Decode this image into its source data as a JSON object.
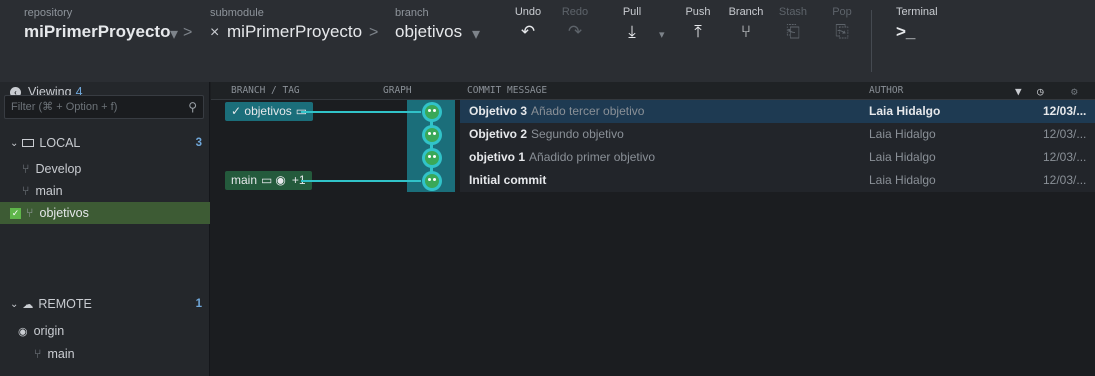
{
  "toolbar": {
    "repo_caption": "repository",
    "repo_name": "miPrimerProyecto",
    "submodule_caption": "submodule",
    "submodule_name": "miPrimerProyecto",
    "branch_caption": "branch",
    "branch_name": "objetivos",
    "chevron": "▾",
    "sep": ">",
    "close": "×",
    "buttons": [
      {
        "label": "Undo",
        "icon": "↶"
      },
      {
        "label": "Redo",
        "icon": "↷"
      },
      {
        "label": "Pull",
        "icon": "⤓"
      },
      {
        "label": "Push",
        "icon": "⤒"
      },
      {
        "label": "Branch",
        "icon": "⑂"
      },
      {
        "label": "Stash",
        "icon": "⎗"
      },
      {
        "label": "Pop",
        "icon": "⎘"
      },
      {
        "label": "Terminal",
        "icon": ">_"
      }
    ],
    "pull_arrow": "▾"
  },
  "sidebar": {
    "viewing_label": "Viewing",
    "viewing_count": "4",
    "filter_placeholder": "Filter (⌘ + Option + f)",
    "search_glyph": "⚲",
    "local": {
      "label": "LOCAL",
      "count": "3",
      "items": [
        "Develop",
        "main",
        "objetivos"
      ]
    },
    "remote": {
      "label": "REMOTE",
      "count": "1",
      "origin": "origin",
      "items": [
        "main"
      ]
    }
  },
  "graph": {
    "headers": {
      "branch": "BRANCH / TAG",
      "graph": "GRAPH",
      "message": "COMMIT MESSAGE",
      "author": "AUTHOR"
    },
    "head_branch": "objetivos",
    "main_branch": "main",
    "main_extra": "+1",
    "commits": [
      {
        "title": "Objetivo 3",
        "desc": "Añado tercer objetivo",
        "author": "Laia Hidalgo",
        "date": "12/03/..."
      },
      {
        "title": "Objetivo 2",
        "desc": "Segundo objetivo",
        "author": "Laia Hidalgo",
        "date": "12/03/..."
      },
      {
        "title": "objetivo 1",
        "desc": "Añadido primer objetivo",
        "author": "Laia Hidalgo",
        "date": "12/03/..."
      },
      {
        "title": "Initial commit",
        "desc": "",
        "author": "Laia Hidalgo",
        "date": "12/03/..."
      }
    ]
  },
  "colors": {
    "accent": "#31c3c9",
    "selection": "#1e3a52",
    "active_branch": "#3d5b34"
  }
}
